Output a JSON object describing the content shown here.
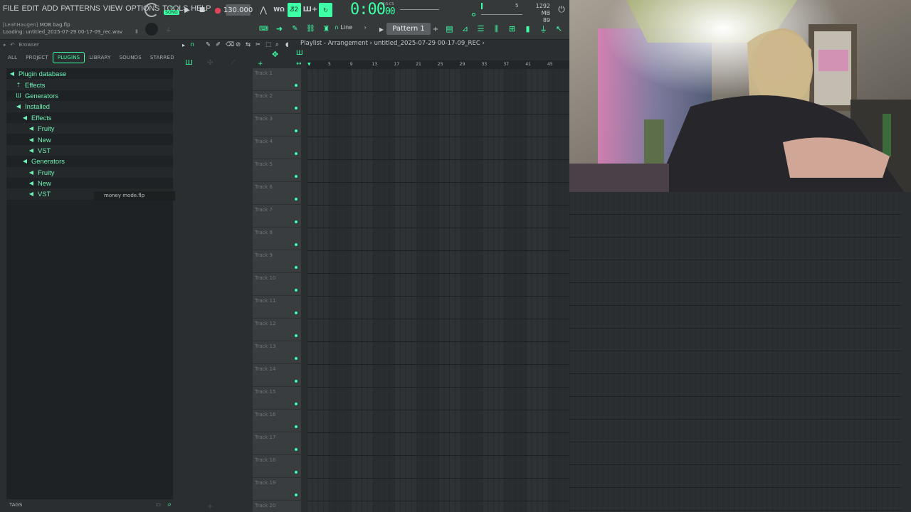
{
  "menu": [
    "FILE",
    "EDIT",
    "ADD",
    "PATTERNS",
    "VIEW",
    "OPTIONS",
    "TOOLS",
    "HELP"
  ],
  "hint": {
    "user": "[LeahHaugen]",
    "file": "MOB bag.flp",
    "loading": "Loading: untitled_2025-07-29 00-17-09_rec.wav"
  },
  "transport": {
    "song_label": "SONG",
    "tempo": "130.000",
    "time": "0:00",
    "time_small": "00",
    "mscs": "M:S:CS"
  },
  "perf": {
    "memory": "1292 MB",
    "cpu": "89",
    "poly": "5"
  },
  "pattern": {
    "label": "Pattern 1",
    "snap": "Line"
  },
  "browser": {
    "title": "Browser",
    "tabs": [
      "ALL",
      "PROJECT",
      "PLUGINS",
      "LIBRARY",
      "SOUNDS",
      "STARRED"
    ],
    "active_tab": "PLUGINS",
    "tree": [
      {
        "label": "Plugin database",
        "indent": 0,
        "icon": "◀"
      },
      {
        "label": "Effects",
        "indent": 1,
        "icon": "⇡"
      },
      {
        "label": "Generators",
        "indent": 1,
        "icon": "Ш"
      },
      {
        "label": "Installed",
        "indent": 1,
        "icon": "◀"
      },
      {
        "label": "Effects",
        "indent": 2,
        "icon": "◀"
      },
      {
        "label": "Fruity",
        "indent": 3,
        "icon": "◀"
      },
      {
        "label": "New",
        "indent": 3,
        "icon": "◀"
      },
      {
        "label": "VST",
        "indent": 3,
        "icon": "◀"
      },
      {
        "label": "Generators",
        "indent": 2,
        "icon": "◀"
      },
      {
        "label": "Fruity",
        "indent": 3,
        "icon": "◀"
      },
      {
        "label": "New",
        "indent": 3,
        "icon": "◀"
      },
      {
        "label": "VST",
        "indent": 3,
        "icon": "◀"
      }
    ],
    "tooltip": "money mode.flp",
    "tags_label": "TAGS"
  },
  "playlist": {
    "crumbs": "Playlist - Arrangement › untitled_2025-07-29 00-17-09_REC ›",
    "ruler": [
      "5",
      "9",
      "13",
      "17",
      "21",
      "25",
      "29",
      "33",
      "37",
      "41",
      "45"
    ],
    "tracks": [
      "Track 1",
      "Track 2",
      "Track 3",
      "Track 4",
      "Track 5",
      "Track 6",
      "Track 7",
      "Track 8",
      "Track 9",
      "Track 10",
      "Track 11",
      "Track 12",
      "Track 13",
      "Track 14",
      "Track 15",
      "Track 16",
      "Track 17",
      "Track 18",
      "Track 19",
      "Track 20"
    ]
  },
  "colors": {
    "accent": "#3dffa5",
    "panel": "#2b2e30",
    "tree_bg": "#1f2224"
  }
}
